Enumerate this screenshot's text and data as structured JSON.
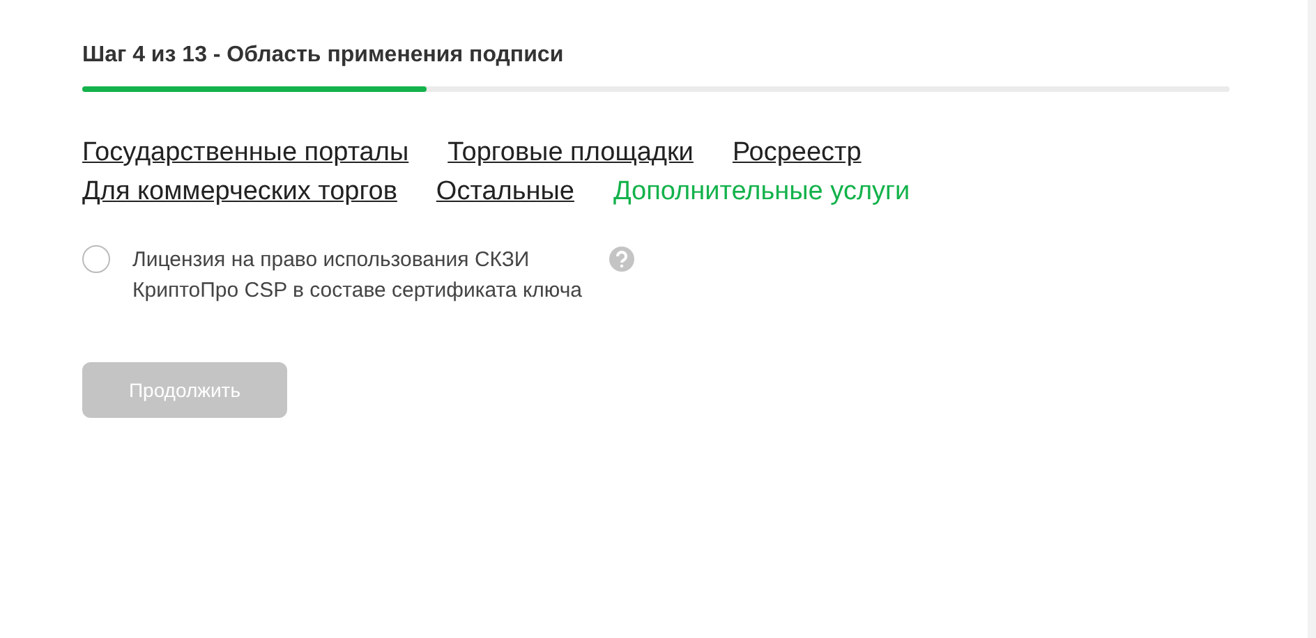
{
  "step_title": "Шаг 4 из 13 - Область применения подписи",
  "progress": {
    "level": 0.3
  },
  "categories": [
    [
      {
        "label": "Государственные порталы",
        "selected": false
      },
      {
        "label": "Торговые площадки",
        "selected": false
      },
      {
        "label": "Росреестр",
        "selected": false
      }
    ],
    [
      {
        "label": "Для коммерческих торгов",
        "selected": false
      },
      {
        "label": "Остальные",
        "selected": false
      },
      {
        "label": "Дополнительные услуги",
        "selected": true
      }
    ]
  ],
  "options": [
    {
      "label": "Лицензия на право использования СКЗИ КриптоПро CSP в составе сертификата ключа",
      "checked": false
    }
  ],
  "continue_button": {
    "label": "Продолжить",
    "disabled": true
  }
}
